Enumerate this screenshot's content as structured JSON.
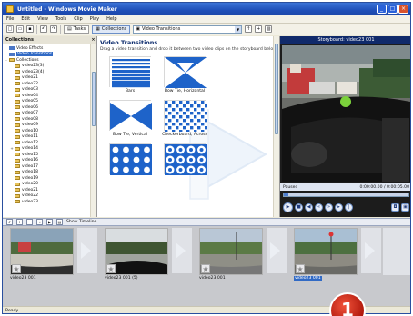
{
  "window": {
    "title": "Untitled - Windows Movie Maker"
  },
  "menu": [
    "File",
    "Edit",
    "View",
    "Tools",
    "Clip",
    "Play",
    "Help"
  ],
  "toolbar": {
    "tasks_label": "Tasks",
    "collections_label": "Collections",
    "dropdown_value": "Video Transitions"
  },
  "collections_pane": {
    "header": "Collections",
    "items": [
      {
        "label": "Video Effects",
        "kind": "film",
        "expander": ""
      },
      {
        "label": "Video Transitions",
        "kind": "film",
        "expander": "",
        "selected": true
      },
      {
        "label": "Collections",
        "kind": "folder",
        "expander": "-"
      },
      {
        "label": "video23(3)",
        "kind": "folder",
        "expander": ""
      },
      {
        "label": "video23(4)",
        "kind": "folder",
        "expander": ""
      },
      {
        "label": "video21",
        "kind": "folder",
        "expander": ""
      },
      {
        "label": "video22",
        "kind": "folder",
        "expander": ""
      },
      {
        "label": "video03",
        "kind": "folder",
        "expander": ""
      },
      {
        "label": "video04",
        "kind": "folder",
        "expander": ""
      },
      {
        "label": "video05",
        "kind": "folder",
        "expander": ""
      },
      {
        "label": "video06",
        "kind": "folder",
        "expander": ""
      },
      {
        "label": "video07",
        "kind": "folder",
        "expander": ""
      },
      {
        "label": "video08",
        "kind": "folder",
        "expander": ""
      },
      {
        "label": "video09",
        "kind": "folder",
        "expander": ""
      },
      {
        "label": "video10",
        "kind": "folder",
        "expander": ""
      },
      {
        "label": "video11",
        "kind": "folder",
        "expander": ""
      },
      {
        "label": "video12",
        "kind": "folder",
        "expander": ""
      },
      {
        "label": "video14",
        "kind": "folder",
        "expander": "+"
      },
      {
        "label": "video15",
        "kind": "folder",
        "expander": ""
      },
      {
        "label": "video16",
        "kind": "folder",
        "expander": ""
      },
      {
        "label": "video17",
        "kind": "folder",
        "expander": ""
      },
      {
        "label": "video18",
        "kind": "folder",
        "expander": ""
      },
      {
        "label": "video19",
        "kind": "folder",
        "expander": ""
      },
      {
        "label": "video20",
        "kind": "folder",
        "expander": ""
      },
      {
        "label": "video21",
        "kind": "folder",
        "expander": ""
      },
      {
        "label": "video22",
        "kind": "folder",
        "expander": ""
      },
      {
        "label": "video23",
        "kind": "folder",
        "expander": ""
      }
    ]
  },
  "content": {
    "heading": "Video Transitions",
    "subtitle": "Drag a video transition and drop it between two video clips on the storyboard below.",
    "transitions": [
      {
        "label": "Bars",
        "pattern": "bars"
      },
      {
        "label": "Bow Tie, Horizontal",
        "pattern": "bowtie-h"
      },
      {
        "label": "Bow Tie, Vertical",
        "pattern": "bowtie-v"
      },
      {
        "label": "Checkerboard, Across",
        "pattern": "checker"
      },
      {
        "label": "",
        "pattern": "dots"
      },
      {
        "label": "",
        "pattern": "circles"
      }
    ]
  },
  "monitor": {
    "title": "Storyboard: video23 001",
    "status": "Paused",
    "time": "0:00:00.00 / 0:00:05.00",
    "progress": 0.04
  },
  "storyboard_toolbar": {
    "label": "Show Timeline"
  },
  "clips": [
    {
      "caption": "video23 001",
      "selected": false
    },
    {
      "caption": "video23 001 (5)",
      "selected": false
    },
    {
      "caption": "video23 001",
      "selected": false
    },
    {
      "caption": "video23 001",
      "selected": true
    }
  ],
  "statusline": "Ready",
  "callout_number": "1",
  "colors": {
    "title_blue": "#1f4fb8",
    "transition_blue": "#1e63c9",
    "selection": "#316ac5",
    "callout_red": "#c8220f"
  }
}
